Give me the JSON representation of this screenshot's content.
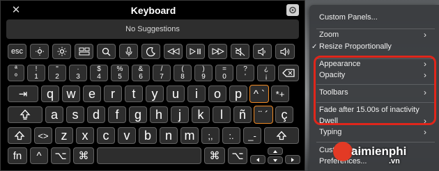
{
  "window": {
    "title": "Keyboard",
    "close_glyph": "✕"
  },
  "suggestions": {
    "text": "No Suggestions"
  },
  "keys": {
    "row_function": [
      "esc",
      "brightness-down-icon",
      "brightness-up-icon",
      "mission-control-icon",
      "search-icon",
      "microphone-icon",
      "moon-icon",
      "rewind-icon",
      "play-pause-icon",
      "fast-forward-icon",
      "mute-icon",
      "volume-down-icon",
      "volume-up-icon"
    ],
    "row_number": [
      {
        "top": "ª",
        "bottom": "º"
      },
      {
        "top": "!",
        "bottom": "1"
      },
      {
        "top": "\"",
        "bottom": "2"
      },
      {
        "top": "·",
        "bottom": "3"
      },
      {
        "top": "$",
        "bottom": "4"
      },
      {
        "top": "%",
        "bottom": "5"
      },
      {
        "top": "&",
        "bottom": "6"
      },
      {
        "top": "/",
        "bottom": "7"
      },
      {
        "top": "(",
        "bottom": "8"
      },
      {
        "top": ")",
        "bottom": "9"
      },
      {
        "top": "=",
        "bottom": "0"
      },
      {
        "top": "?",
        "bottom": "'"
      },
      {
        "top": "¿",
        "bottom": "¡"
      }
    ],
    "row_q": [
      "⇥",
      "q",
      "w",
      "e",
      "r",
      "t",
      "y",
      "u",
      "i",
      "o",
      "p",
      "^ `",
      "*+"
    ],
    "row_a": [
      "a",
      "s",
      "d",
      "f",
      "g",
      "h",
      "j",
      "k",
      "l",
      "ñ",
      "¨ ´",
      "ç"
    ],
    "row_z": [
      "<>",
      "z",
      "x",
      "c",
      "v",
      "b",
      "n",
      "m",
      ";,",
      ":.",
      "_-"
    ],
    "row_bottom": [
      "fn",
      "^",
      "⌥",
      "⌘",
      "⌘",
      "⌥"
    ]
  },
  "menu": {
    "items": [
      {
        "label": "Custom Panels...",
        "arrow": false,
        "checked": false
      },
      {
        "label": "Zoom",
        "arrow": true,
        "checked": false
      },
      {
        "label": "Resize Proportionally",
        "arrow": false,
        "checked": true
      },
      {
        "label": "Appearance",
        "arrow": true,
        "checked": false
      },
      {
        "label": "Opacity",
        "arrow": true,
        "checked": false
      },
      {
        "label": "Toolbars",
        "arrow": true,
        "checked": false
      },
      {
        "label": "Fade after 15.00s of inactivity",
        "arrow": false,
        "checked": false
      },
      {
        "label": "Dwell",
        "arrow": true,
        "checked": false
      },
      {
        "label": "Typing",
        "arrow": true,
        "checked": false
      },
      {
        "label": "Customize...",
        "arrow": false,
        "checked": false
      },
      {
        "label": "Preferences...",
        "arrow": false,
        "checked": false
      }
    ],
    "chevron": "›",
    "checkmark": "✓"
  },
  "watermark": {
    "text": "aimienphi",
    "sub": ".vn"
  },
  "colors": {
    "highlight_key": "#f08a24",
    "callout": "#e0261b",
    "menu_bg": "#3a3c3f"
  }
}
